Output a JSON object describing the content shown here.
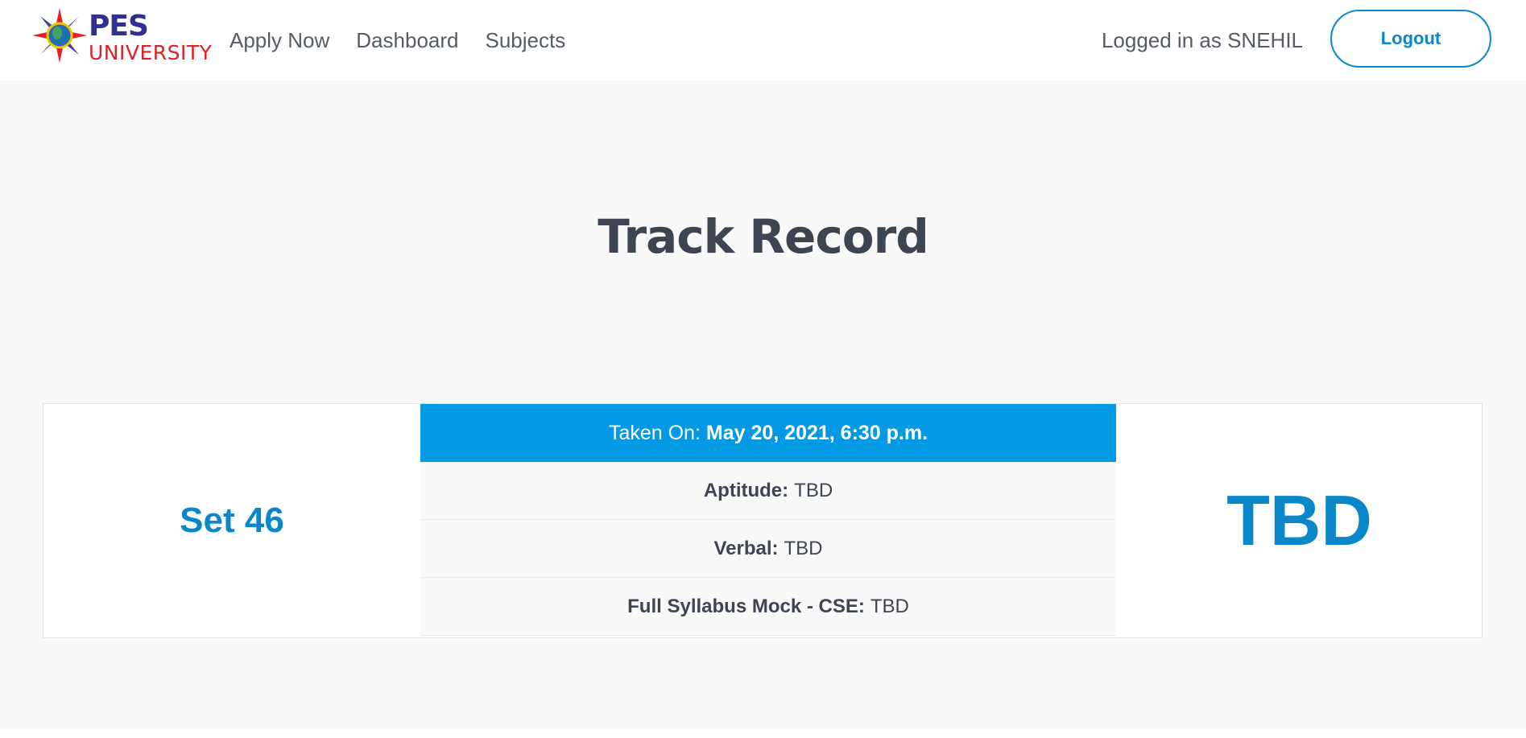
{
  "brand": {
    "name": "PES",
    "subtitle": "UNIVERSITY",
    "colors": {
      "primary": "#2e3192",
      "secondary": "#e31e24"
    }
  },
  "nav": {
    "links": [
      {
        "label": "Apply Now"
      },
      {
        "label": "Dashboard"
      },
      {
        "label": "Subjects"
      }
    ],
    "logged_in_text": "Logged in as SNEHIL",
    "logout_label": "Logout"
  },
  "page": {
    "title": "Track Record"
  },
  "record": {
    "set_label": "Set 46",
    "taken_on_label": "Taken On:",
    "taken_on_value": "May 20, 2021, 6:30 p.m.",
    "scores": [
      {
        "label": "Aptitude:",
        "value": "TBD"
      },
      {
        "label": "Verbal:",
        "value": "TBD"
      },
      {
        "label": "Full Syllabus Mock - CSE:",
        "value": "TBD"
      }
    ],
    "overall": "TBD"
  },
  "colors": {
    "accent": "#0a87c9",
    "header_bar": "#0399e3",
    "background": "#f9f9f9"
  }
}
